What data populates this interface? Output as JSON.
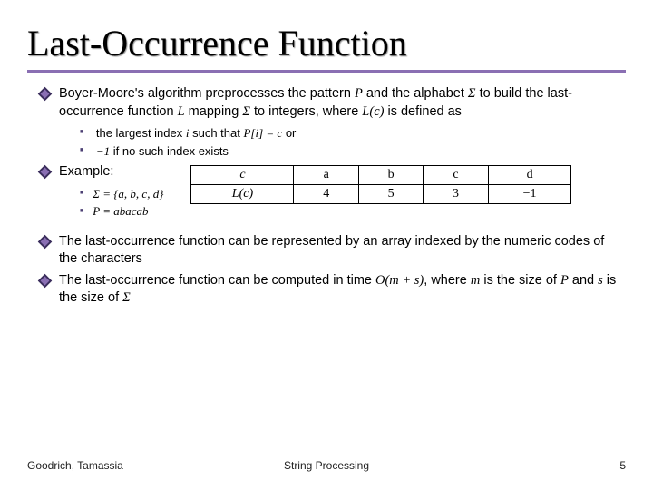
{
  "title": "Last-Occurrence Function",
  "bullets": {
    "b1": "Boyer-Moore's algorithm preprocesses the pattern ",
    "b1_P": "P",
    "b1_mid1": " and the alphabet ",
    "b1_sigma1": "Σ",
    "b1_mid2": " to build the last-occurrence function ",
    "b1_L": "L",
    "b1_mid3": " mapping ",
    "b1_sigma2": "Σ",
    "b1_mid4": " to integers, where ",
    "b1_Lc": "L(c)",
    "b1_end": " is defined as",
    "sub1a": "the largest index ",
    "sub1a_i": "i",
    "sub1a_mid": " such that ",
    "sub1a_eq": "P[i] = c",
    "sub1a_end": " or",
    "sub1b_neg1": "−1",
    "sub1b": " if no such index exists",
    "b2": "Example:",
    "sub2a_sigma": "Σ = {a, b, c, d}",
    "sub2b_p": "P = abacab",
    "b3": "The last-occurrence function can be represented by an array indexed by the numeric codes of the characters",
    "b4": "The last-occurrence function can be computed in time ",
    "b4_O": "O(m + s)",
    "b4_mid": ", where ",
    "b4_m": "m",
    "b4_mid2": " is the size of ",
    "b4_P": "P",
    "b4_mid3": " and ",
    "b4_s": "s",
    "b4_mid4": " is the size of ",
    "b4_sigma": "Σ"
  },
  "table": {
    "h0": "c",
    "h1": "a",
    "h2": "b",
    "h3": "c",
    "h4": "d",
    "r0": "L(c)",
    "r1": "4",
    "r2": "5",
    "r3": "3",
    "r4": "−1"
  },
  "footer": {
    "left": "Goodrich, Tamassia",
    "center": "String Processing",
    "right": "5"
  },
  "chart_data": {
    "type": "table",
    "title": "Last-occurrence function L(c) for P = abacab over Σ = {a, b, c, d}",
    "columns": [
      "c",
      "a",
      "b",
      "c",
      "d"
    ],
    "rows": [
      [
        "L(c)",
        4,
        5,
        3,
        -1
      ]
    ]
  }
}
